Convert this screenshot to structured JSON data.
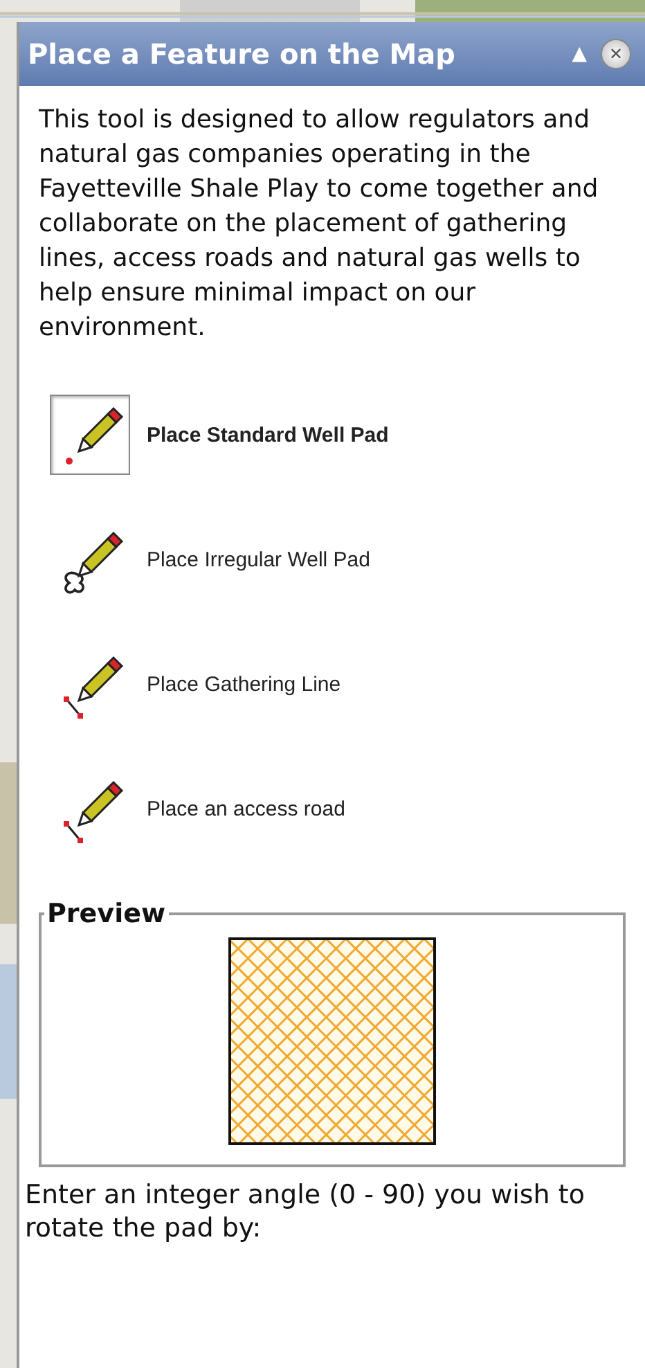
{
  "panel": {
    "title": "Place a Feature on the Map",
    "collapse_glyph": "▲",
    "close_glyph": "✕"
  },
  "description": "This tool is designed to allow regulators and natural gas companies operating in the Fayetteville Shale Play to come together and collaborate on the placement of gathering lines, access roads and natural gas wells to help ensure minimal impact on our environment.",
  "tools": [
    {
      "label": "Place Standard Well Pad",
      "kind": "point",
      "selected": true
    },
    {
      "label": "Place Irregular Well Pad",
      "kind": "polygon",
      "selected": false
    },
    {
      "label": "Place Gathering Line",
      "kind": "line",
      "selected": false
    },
    {
      "label": "Place an access road",
      "kind": "line",
      "selected": false
    }
  ],
  "preview": {
    "legend": "Preview"
  },
  "angle_prompt": "Enter an integer angle (0 - 90) you wish to rotate the pad by:"
}
